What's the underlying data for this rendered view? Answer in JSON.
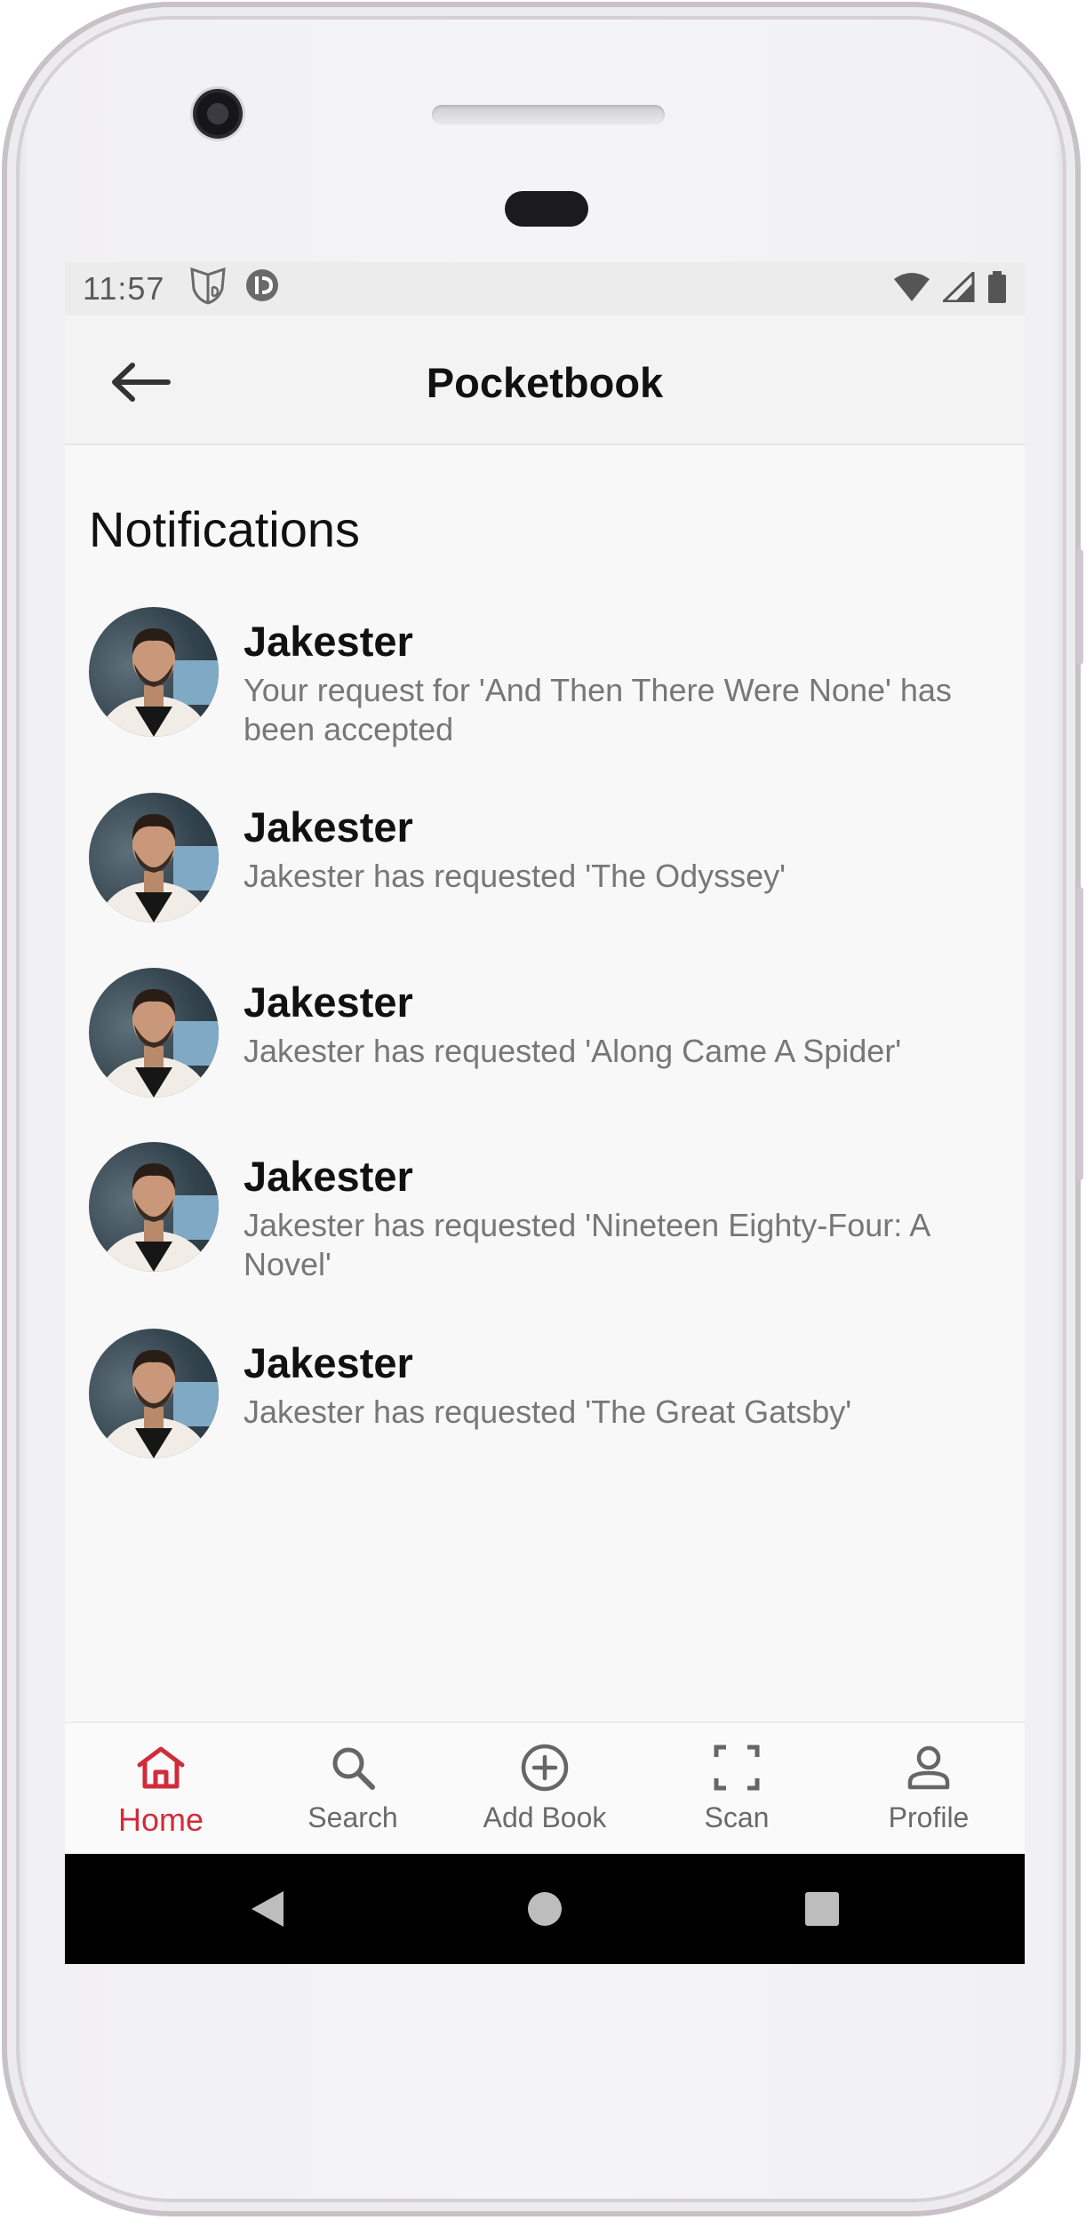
{
  "status_bar": {
    "time": "11:57"
  },
  "app_bar": {
    "title": "Pocketbook"
  },
  "section": {
    "title": "Notifications"
  },
  "notifications": [
    {
      "name": "Jakester",
      "message": "Your request for 'And Then There Were None' has been accepted"
    },
    {
      "name": "Jakester",
      "message": "Jakester has requested 'The Odyssey'"
    },
    {
      "name": "Jakester",
      "message": "Jakester has requested 'Along Came A Spider'"
    },
    {
      "name": "Jakester",
      "message": "Jakester has requested 'Nineteen Eighty-Four: A Novel'"
    },
    {
      "name": "Jakester",
      "message": "Jakester has requested 'The Great Gatsby'"
    }
  ],
  "bottom_nav": {
    "active_color": "#d12c3b",
    "items": [
      {
        "label": "Home",
        "icon": "home-icon",
        "active": true
      },
      {
        "label": "Search",
        "icon": "search-icon",
        "active": false
      },
      {
        "label": "Add Book",
        "icon": "add-circle-icon",
        "active": false
      },
      {
        "label": "Scan",
        "icon": "scan-icon",
        "active": false
      },
      {
        "label": "Profile",
        "icon": "person-icon",
        "active": false
      }
    ]
  }
}
